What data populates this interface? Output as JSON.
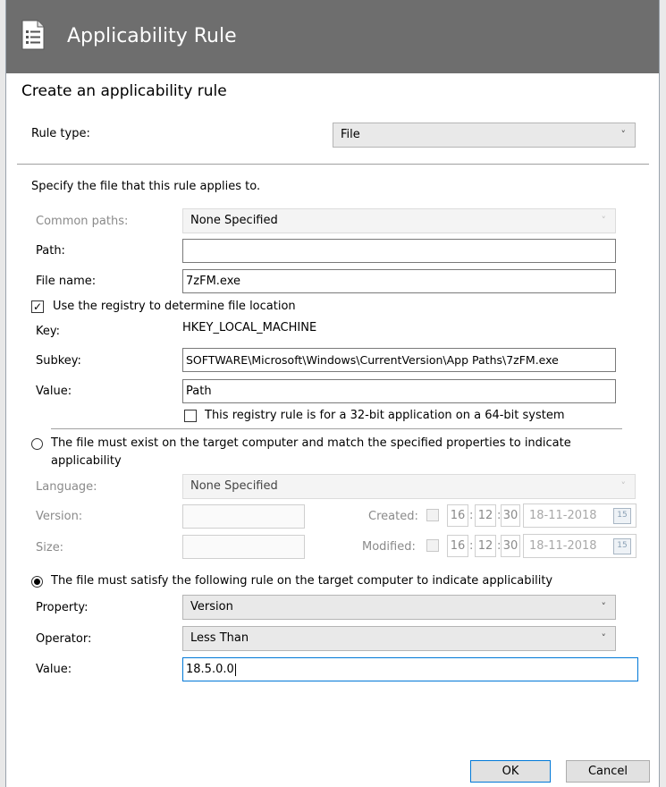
{
  "window": {
    "title": "Applicability Rule",
    "title_icon": "document-list-icon"
  },
  "heading": "Create an applicability rule",
  "rule_type": {
    "label": "Rule type:",
    "value": "File"
  },
  "file_section": {
    "instruction": "Specify the file that this rule applies to.",
    "common_paths": {
      "label": "Common paths:",
      "value": "None Specified"
    },
    "path": {
      "label": "Path:",
      "value": ""
    },
    "file_name": {
      "label": "File name:",
      "value": "7zFM.exe"
    }
  },
  "registry": {
    "checkbox_label": "Use the registry to determine file location",
    "checked": true,
    "key": {
      "label": "Key:",
      "value": "HKEY_LOCAL_MACHINE"
    },
    "subkey": {
      "label": "Subkey:",
      "value": "SOFTWARE\\Microsoft\\Windows\\CurrentVersion\\App Paths\\7zFM.exe"
    },
    "value": {
      "label": "Value:",
      "value": "Path"
    },
    "bit32_label": "This registry rule is for a 32-bit application on a 64-bit system",
    "bit32_checked": false
  },
  "option_exist": {
    "label_line1": "The file must exist on the target computer and match the specified properties to indicate",
    "label_line2": "applicability",
    "selected": false,
    "language": {
      "label": "Language:",
      "value": "None Specified"
    },
    "version": {
      "label": "Version:",
      "value": ""
    },
    "size": {
      "label": "Size:",
      "value": ""
    },
    "created": {
      "label": "Created:",
      "hour": "16",
      "minute": "12",
      "second": "30",
      "date": "18-11-2018",
      "calendar_day": "15"
    },
    "modified": {
      "label": "Modified:",
      "hour": "16",
      "minute": "12",
      "second": "30",
      "date": "18-11-2018",
      "calendar_day": "15"
    }
  },
  "option_rule": {
    "label": "The file must satisfy the following rule on the target computer to indicate applicability",
    "selected": true,
    "property": {
      "label": "Property:",
      "value": "Version"
    },
    "operator": {
      "label": "Operator:",
      "value": "Less Than"
    },
    "value": {
      "label": "Value:",
      "value": "18.5.0.0"
    }
  },
  "buttons": {
    "ok": "OK",
    "cancel": "Cancel"
  },
  "symbols": {
    "chevron": "˅",
    "check": "✓",
    "colon": ":"
  },
  "colors": {
    "titlebar": "#6e6e6e",
    "focus_border": "#0078d7",
    "disabled_text": "#8a8a8a"
  }
}
